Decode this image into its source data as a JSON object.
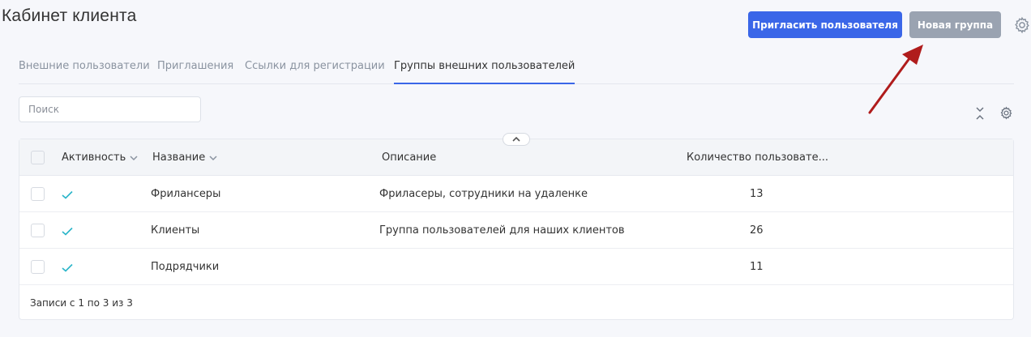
{
  "header": {
    "title": "Кабинет клиента",
    "invite_button": "Пригласить пользователя",
    "new_group_button": "Новая группа"
  },
  "tabs": [
    {
      "label": "Внешние пользователи",
      "active": false
    },
    {
      "label": "Приглашения",
      "active": false
    },
    {
      "label": "Ссылки для регистрации",
      "active": false
    },
    {
      "label": "Группы внешних пользователей",
      "active": true
    }
  ],
  "search": {
    "placeholder": "Поиск",
    "value": ""
  },
  "table": {
    "columns": [
      "Активность",
      "Название",
      "Описание",
      "Количество пользовате..."
    ],
    "rows": [
      {
        "active": true,
        "name": "Фрилансеры",
        "description": "Фриласеры, сотрудники на удаленке",
        "count": "13"
      },
      {
        "active": true,
        "name": "Клиенты",
        "description": "Группа пользователей для наших клиентов",
        "count": "26"
      },
      {
        "active": true,
        "name": "Подрядчики",
        "description": "",
        "count": "11"
      }
    ],
    "footer": "Записи с 1 по 3 из 3"
  },
  "colors": {
    "primary": "#3a66e8",
    "secondary_button": "#9aa3b1",
    "check": "#2ab5c9",
    "annotation_arrow": "#b01c1c"
  },
  "icons": [
    "gear-icon",
    "collapse-icon",
    "chevron-up-icon",
    "chevron-down-icon",
    "check-icon"
  ]
}
